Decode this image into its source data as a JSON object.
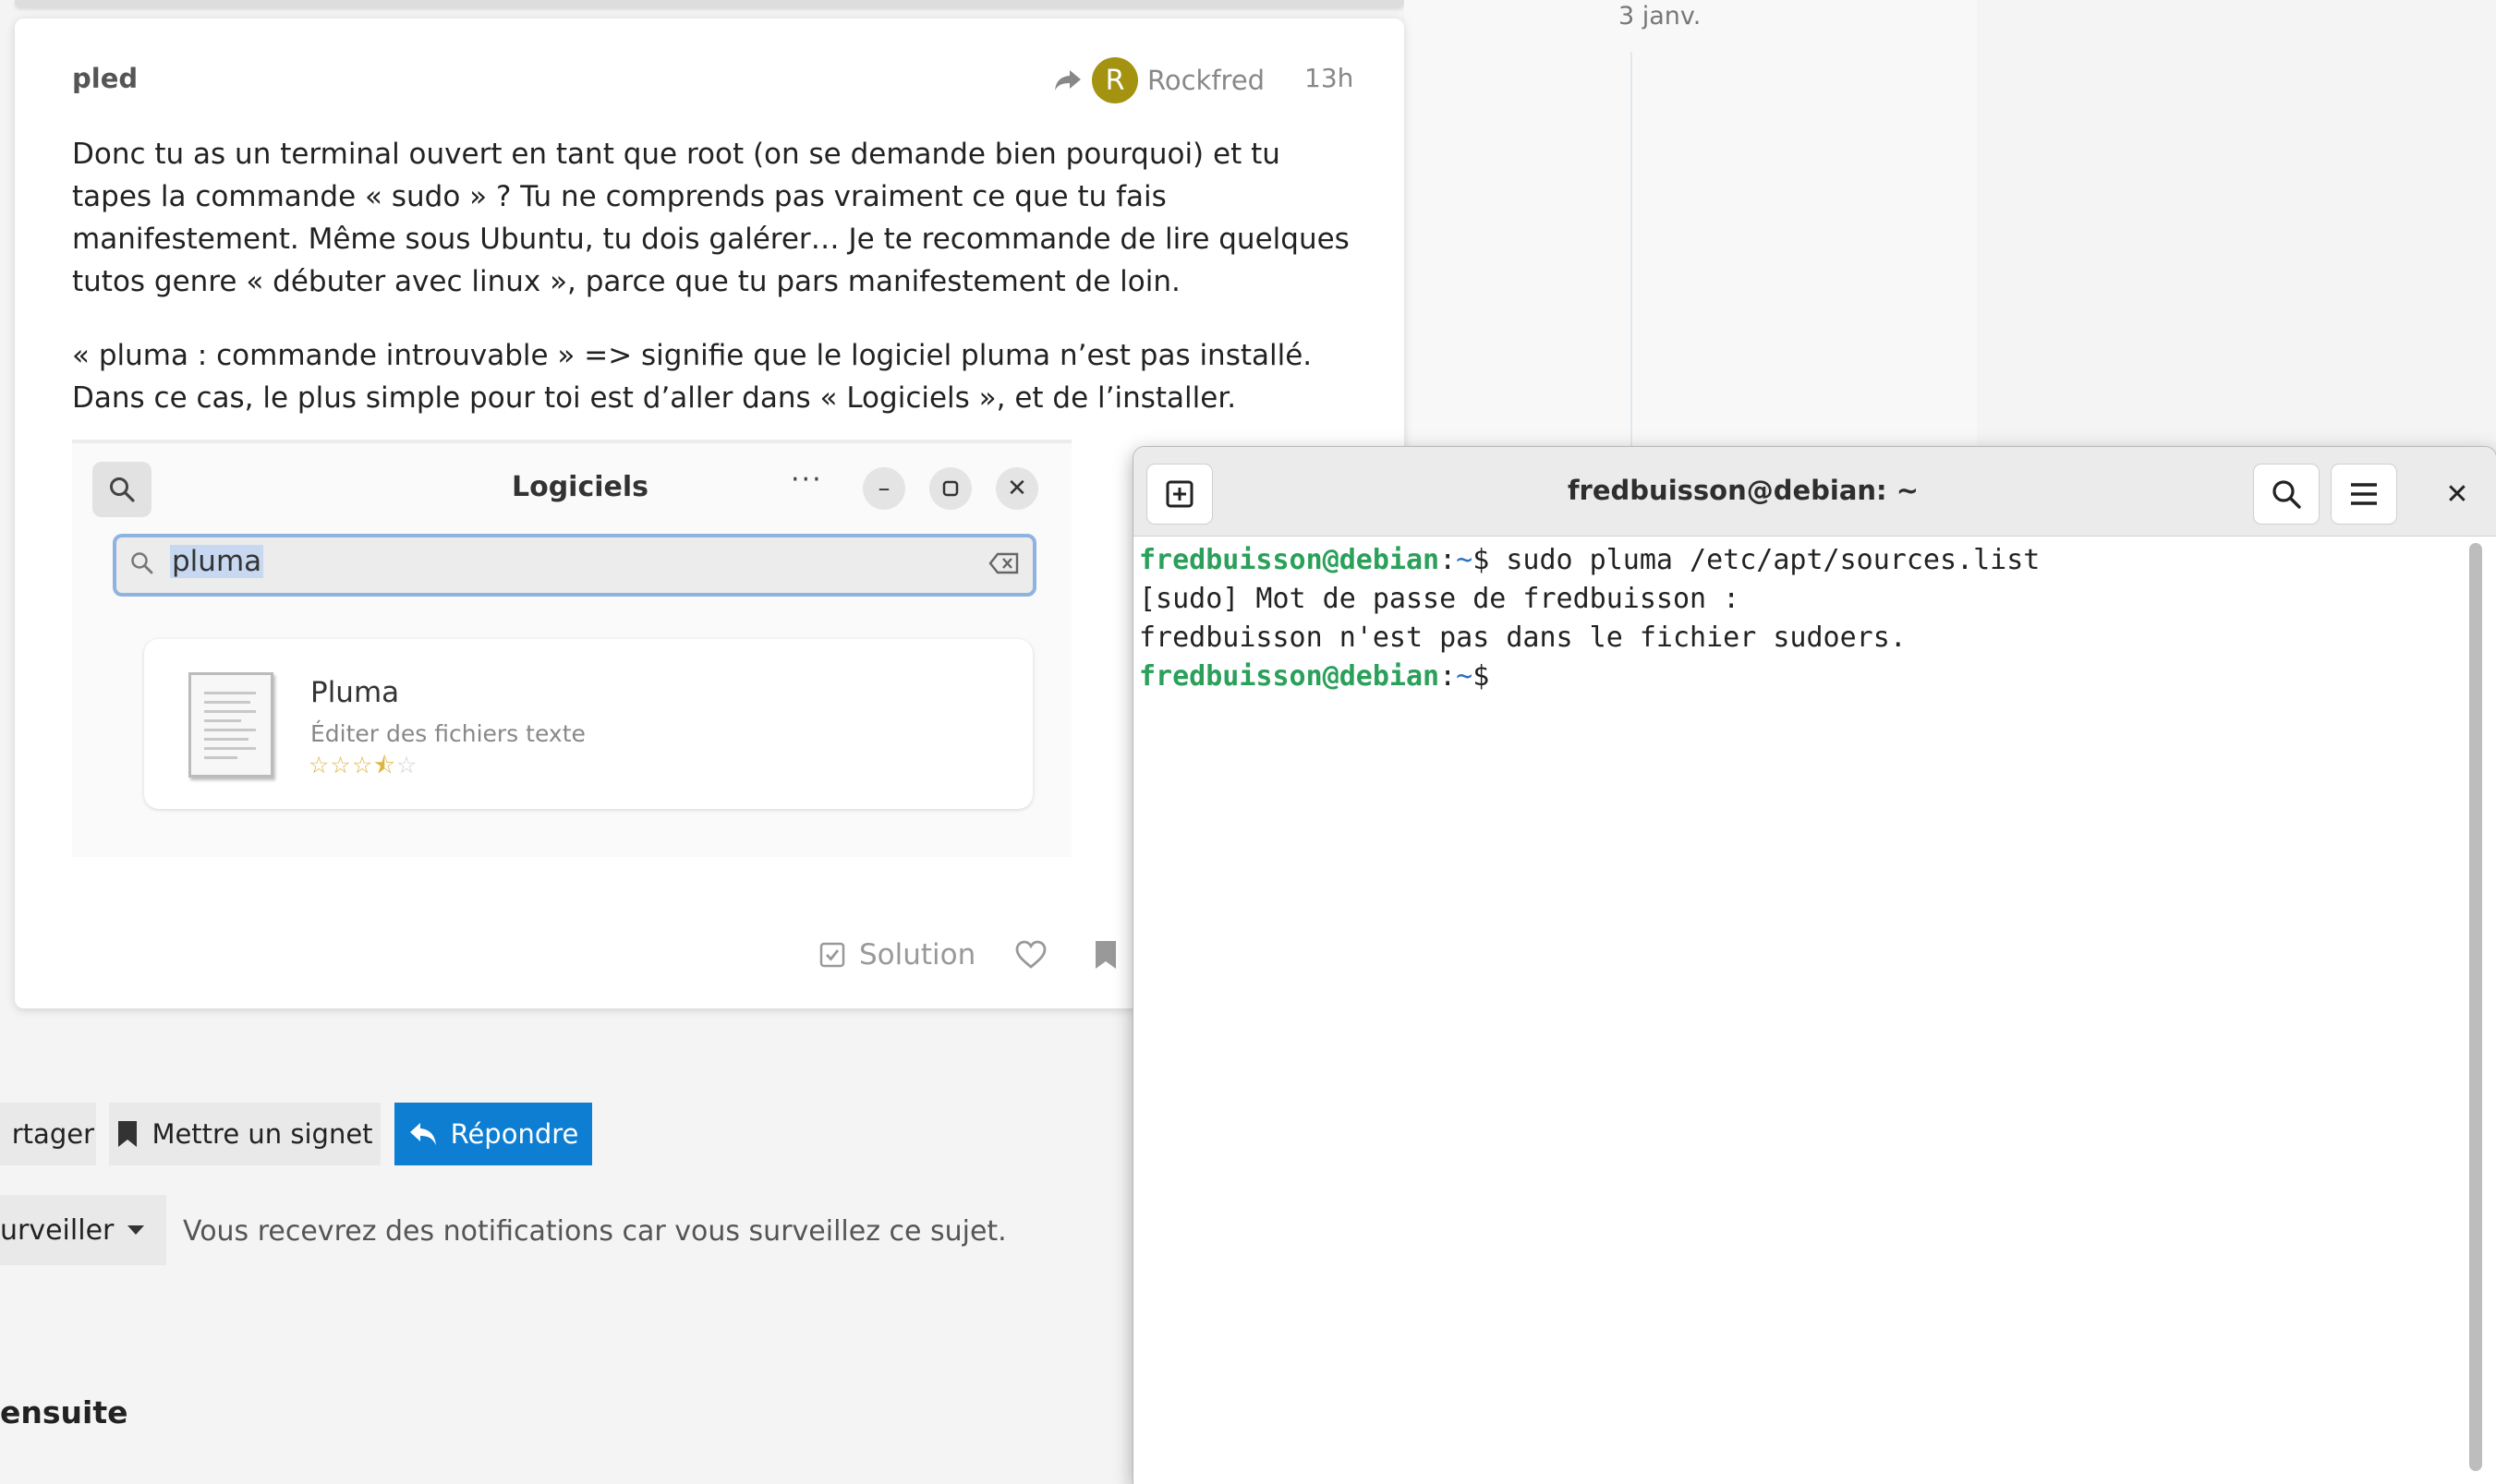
{
  "timeline": {
    "date": "3 janv."
  },
  "post": {
    "author": "pled",
    "reply_to": {
      "avatar_letter": "R",
      "name": "Rockfred"
    },
    "time": "13h",
    "paragraph1": "Donc tu as un terminal ouvert en tant que root (on se demande bien pourquoi) et tu tapes la commande « sudo » ? Tu ne comprends pas vraiment ce que tu fais manifestement. Même sous Ubuntu, tu dois galérer… Je te recommande de lire quelques tutos genre « débuter avec linux », parce que tu pars manifestement de loin.",
    "paragraph2": "« pluma : commande introuvable » => signifie que le logiciel pluma n’est pas installé. Dans ce cas, le plus simple pour toi est d’aller dans « Logiciels », et de l’installer.",
    "screenshot": {
      "window_title": "Logiciels",
      "search_value": "pluma",
      "app_name": "Pluma",
      "app_description": "Éditer des fichiers texte",
      "rating_stars": 3.5
    },
    "actions": {
      "solution_label": "Solution"
    }
  },
  "topic_footer": {
    "share_label": "rtager",
    "bookmark_label": "Mettre un signet",
    "reply_label": "Répondre",
    "watch_label": "urveiller",
    "notification_text": "Vous recevrez des notifications car vous surveillez ce sujet.",
    "next_heading": "ensuite"
  },
  "terminal": {
    "title": "fredbuisson@debian: ~",
    "line1": {
      "user_host": "fredbuisson@debian",
      "sep": ":",
      "path": "~",
      "prompt": "$",
      "command": " sudo pluma /etc/apt/sources.list"
    },
    "line2": "[sudo] Mot de passe de fredbuisson :",
    "line3": "fredbuisson n'est pas dans le fichier sudoers.",
    "line4": {
      "user_host": "fredbuisson@debian",
      "sep": ":",
      "path": "~",
      "prompt": "$"
    }
  }
}
